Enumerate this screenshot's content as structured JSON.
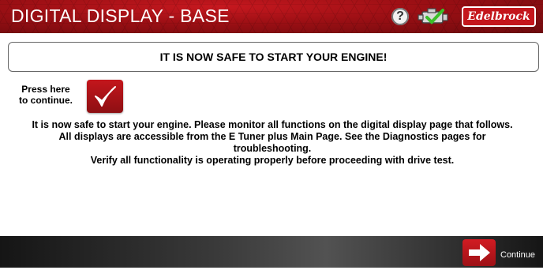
{
  "header": {
    "title": "DIGITAL DISPLAY - BASE",
    "help_label": "?",
    "brand": "Edelbrock"
  },
  "banner": {
    "message": "IT IS NOW SAFE TO START YOUR ENGINE!"
  },
  "press": {
    "line1": "Press here",
    "line2": "to continue."
  },
  "body": {
    "line1": "It is now safe to start your engine. Please monitor all functions on the digital display page that follows.",
    "line2": "All displays are accessible from the E Tuner plus Main Page. See the Diagnostics pages for",
    "line3": "troubleshooting.",
    "line4": "Verify all functionality is operating properly before proceeding with drive test."
  },
  "footer": {
    "continue_label": "Continue"
  },
  "colors": {
    "accent_red": "#c4161c",
    "check_green": "#3bbf2a"
  }
}
